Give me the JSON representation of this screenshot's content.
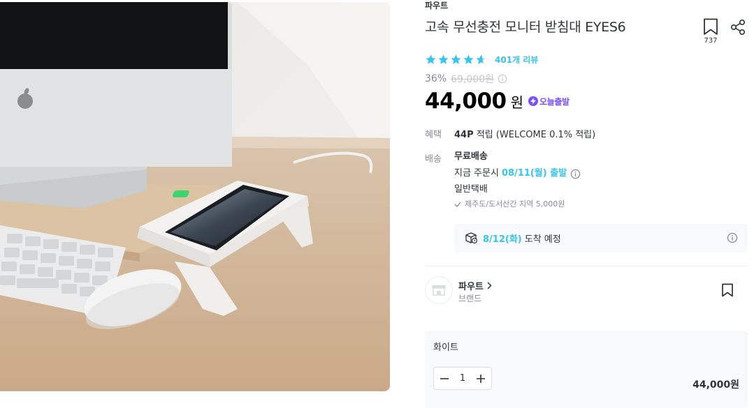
{
  "product": {
    "brand": "파우트",
    "title": "고속 무선충전 모니터 받침대 EYES6",
    "bookmark_count": "737",
    "rating": 4.5,
    "review_count": "401개 리뷰",
    "discount": "36%",
    "original_price": "69,000원",
    "price": "44,000",
    "price_unit": "원",
    "today_badge": "오늘출발"
  },
  "benefit": {
    "label": "혜택",
    "points": "44P",
    "rest": " 적립 (WELCOME 0.1% 적립)"
  },
  "delivery": {
    "label": "배송",
    "type": "무료배송",
    "order_now": "지금 주문시",
    "ship_date": "08/11(월) 출발",
    "carrier": "일반택배",
    "extra_fee": "제주도/도서산간 지역 5,000원",
    "arrival_date": "8/12(화)",
    "arrival_text": "도착 예정"
  },
  "seller": {
    "name": "파우트",
    "sub": "브랜드"
  },
  "option": {
    "name": "화이트",
    "quantity": "1",
    "price": "44,000원"
  },
  "colors": {
    "accent": "#35c5f0",
    "today": "#7b4dff",
    "text": "#2f3438",
    "muted": "#828c94"
  }
}
